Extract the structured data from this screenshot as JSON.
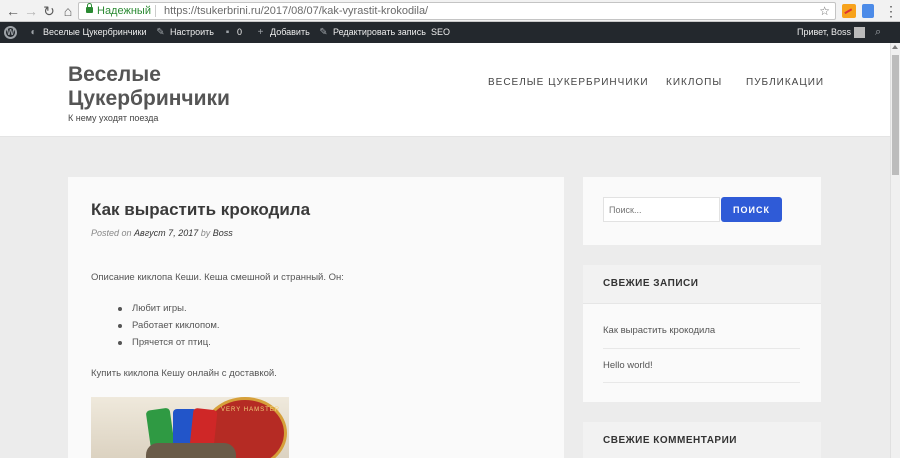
{
  "browser": {
    "secure_label": "Надежный",
    "url_host": "https://tsukerbrini.ru",
    "url_path": "/2017/08/07/kak-vyrastit-krokodila/"
  },
  "adminbar": {
    "site_name": "Веселые Цукербринчики",
    "customize": "Настроить",
    "comments_count": "0",
    "add_new": "Добавить",
    "edit_post": "Редактировать запись",
    "seo": "SEO",
    "greeting": "Привет, Boss"
  },
  "header": {
    "title_line1": "Веселые",
    "title_line2": "Цукербринчики",
    "tagline": "К нему уходят поезда",
    "nav": [
      "ВЕСЕЛЫЕ ЦУКЕРБРИНЧИКИ",
      "КИКЛОПЫ",
      "ПУБЛИКАЦИИ"
    ]
  },
  "post": {
    "title": "Как вырастить крокодила",
    "meta_posted_on": "Posted on",
    "meta_date": "Август 7, 2017",
    "meta_by": "by",
    "meta_author": "Boss",
    "intro": "Описание киклопа Кеши. Кеша смешной и странный. Он:",
    "list": [
      "Любит игры.",
      "Работает киклопом.",
      "Прячется от птиц."
    ],
    "buy": "Купить киклопа Кешу онлайн с доставкой.",
    "image_text": "VERY HAMSTER"
  },
  "sidebar": {
    "search_placeholder": "Поиск...",
    "search_button": "ПОИСК",
    "recent_title": "СВЕЖИЕ ЗАПИСИ",
    "recent_posts": [
      "Как вырастить крокодила",
      "Hello world!"
    ],
    "comments_title": "СВЕЖИЕ КОММЕНТАРИИ"
  }
}
